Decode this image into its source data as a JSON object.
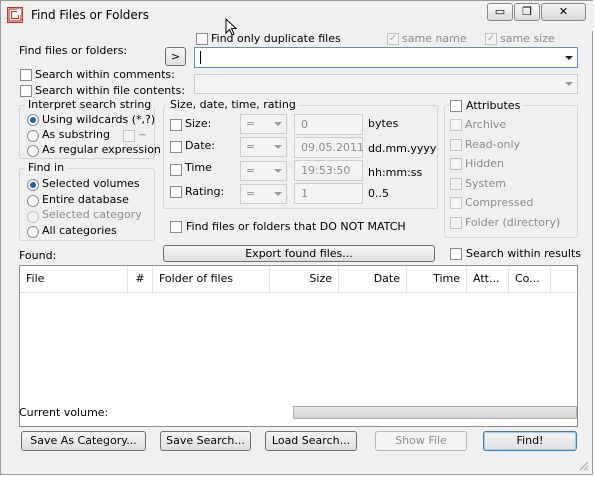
{
  "window": {
    "title": "Find Files or Folders"
  },
  "search": {
    "label": "Find files or folders:",
    "expand_label": ">",
    "query_value": "",
    "duplicates_label": "Find only duplicate files",
    "same_name_label": "same name",
    "same_size_label": "same size",
    "within_comments_label": "Search within comments:",
    "within_contents_label": "Search within file contents:"
  },
  "interpret": {
    "title": "Interpret search string",
    "wildcards_label": "Using wildcards (*,?)",
    "substring_label": "As substring",
    "tilde_label": "~",
    "regex_label": "As regular expression"
  },
  "find_in": {
    "title": "Find in",
    "selected_volumes_label": "Selected volumes",
    "entire_database_label": "Entire database",
    "selected_category_label": "Selected category",
    "all_categories_label": "All categories"
  },
  "criteria": {
    "title": "Size, date, time, rating",
    "size_label": "Size:",
    "size_op": "=",
    "size_value": "0",
    "size_unit": "bytes",
    "date_label": "Date:",
    "date_op": "=",
    "date_value": "09.05.2011",
    "date_format": "dd.mm.yyyy",
    "time_label": "Time",
    "time_op": "=",
    "time_value": "19:53:50",
    "time_format": "hh:mm:ss",
    "rating_label": "Rating:",
    "rating_op": "=",
    "rating_value": "1",
    "rating_range": "0..5",
    "not_match_label": "Find files or folders that DO NOT MATCH"
  },
  "attributes": {
    "title": "Attributes",
    "archive": "Archive",
    "readonly": "Read-only",
    "hidden": "Hidden",
    "system": "System",
    "compressed": "Compressed",
    "folder": "Folder (directory)"
  },
  "results": {
    "export_label": "Export found files...",
    "within_results_label": "Search within results",
    "found_label": "Found:",
    "columns": [
      "File",
      "#",
      "Folder of files",
      "Size",
      "Date",
      "Time",
      "Att...",
      "Co..."
    ]
  },
  "status": {
    "current_volume_label": "Current volume:"
  },
  "buttons": {
    "save_category": "Save As Category...",
    "save_search": "Save Search...",
    "load_search": "Load Search...",
    "show_file": "Show File",
    "find": "Find!"
  },
  "window_controls": {
    "minimize": "▭",
    "maximize": "❐",
    "close": "✕"
  },
  "colors": {
    "radio_dot": "#1b5fb3",
    "default_button_border": "#3c7fb1"
  }
}
